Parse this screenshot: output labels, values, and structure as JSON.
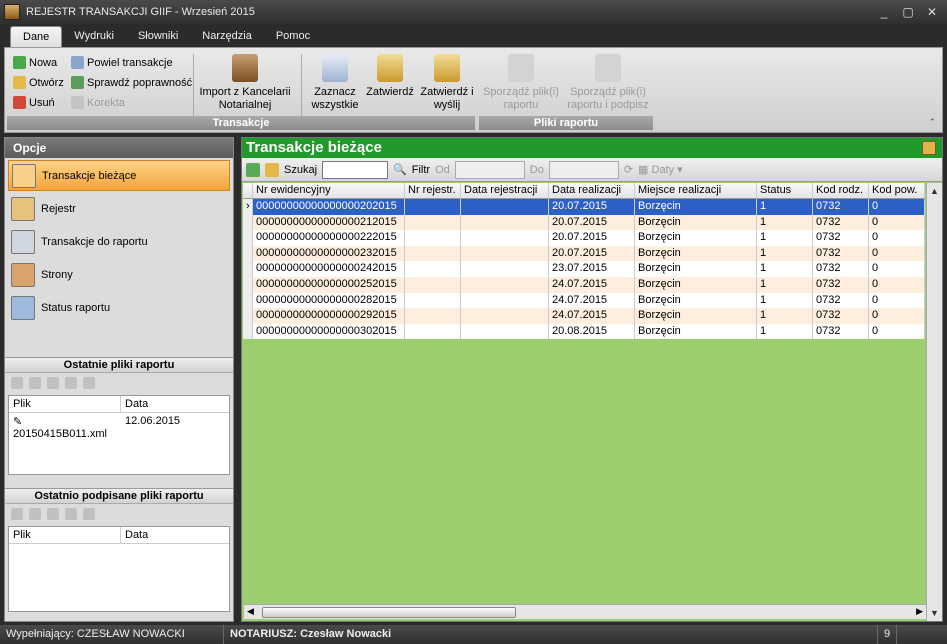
{
  "window": {
    "title": "REJESTR TRANSAKCJI GIIF - Wrzesień 2015"
  },
  "menu_tabs": [
    "Dane",
    "Wydruki",
    "Słowniki",
    "Narzędzia",
    "Pomoc"
  ],
  "ribbon": {
    "transakcje": {
      "label": "Transakcje",
      "nowa": "Nowa",
      "otworz": "Otwórz",
      "usun": "Usuń",
      "powiel": "Powiel transakcje",
      "sprawdz": "Sprawdź poprawność",
      "korekta": "Korekta",
      "import": "Import z Kancelarii Notarialnej",
      "zaznacz": "Zaznacz wszystkie",
      "zatwierdz": "Zatwierdź",
      "zatwierdz_wyslij": "Zatwierdź i wyślij"
    },
    "pliki": {
      "label": "Pliki raportu",
      "sporzadz": "Sporządź plik(i) raportu",
      "sporzadz_podpisz": "Sporządź plik(i) raportu i podpisz"
    }
  },
  "left": {
    "header": "Opcje",
    "options": [
      "Transakcje bieżące",
      "Rejestr",
      "Transakcje do raportu",
      "Strony",
      "Status raportu"
    ],
    "recent_title": "Ostatnie pliki raportu",
    "recent_cols": [
      "Plik",
      "Data"
    ],
    "recent_rows": [
      [
        "20150415B011.xml",
        "12.06.2015"
      ]
    ],
    "signed_title": "Ostatnio podpisane pliki raportu",
    "signed_cols": [
      "Plik",
      "Data"
    ]
  },
  "right": {
    "header": "Transakcje bieżące",
    "search_label": "Szukaj",
    "search_value": "",
    "filter_label": "Filtr",
    "od_label": "Od",
    "do_label": "Do",
    "daty_label": "Daty",
    "columns": [
      "Nr ewidencyjny",
      "Nr rejestr.",
      "Data rejestracji",
      "Data realizacji",
      "Miejsce realizacji",
      "Status",
      "Kod rodz.",
      "Kod pow."
    ],
    "rows": [
      [
        "00000000000000000202015",
        "",
        "",
        "20.07.2015",
        "Borzęcin",
        "1",
        "0732",
        "0"
      ],
      [
        "00000000000000000212015",
        "",
        "",
        "20.07.2015",
        "Borzęcin",
        "1",
        "0732",
        "0"
      ],
      [
        "00000000000000000222015",
        "",
        "",
        "20.07.2015",
        "Borzęcin",
        "1",
        "0732",
        "0"
      ],
      [
        "00000000000000000232015",
        "",
        "",
        "20.07.2015",
        "Borzęcin",
        "1",
        "0732",
        "0"
      ],
      [
        "00000000000000000242015",
        "",
        "",
        "23.07.2015",
        "Borzęcin",
        "1",
        "0732",
        "0"
      ],
      [
        "00000000000000000252015",
        "",
        "",
        "24.07.2015",
        "Borzęcin",
        "1",
        "0732",
        "0"
      ],
      [
        "00000000000000000282015",
        "",
        "",
        "24.07.2015",
        "Borzęcin",
        "1",
        "0732",
        "0"
      ],
      [
        "00000000000000000292015",
        "",
        "",
        "24.07.2015",
        "Borzęcin",
        "1",
        "0732",
        "0"
      ],
      [
        "00000000000000000302015",
        "",
        "",
        "20.08.2015",
        "Borzęcin",
        "1",
        "0732",
        "0"
      ]
    ]
  },
  "status": {
    "wypelniajacy": "Wypełniający: CZESŁAW NOWACKI",
    "notariusz": "NOTARIUSZ: Czesław Nowacki",
    "count": "9"
  },
  "colors": {
    "accent_green": "#1f9a2b",
    "grid_bg": "#9bcf6d",
    "selection": "#2d60c7",
    "selected_option": "#f3a33a"
  }
}
